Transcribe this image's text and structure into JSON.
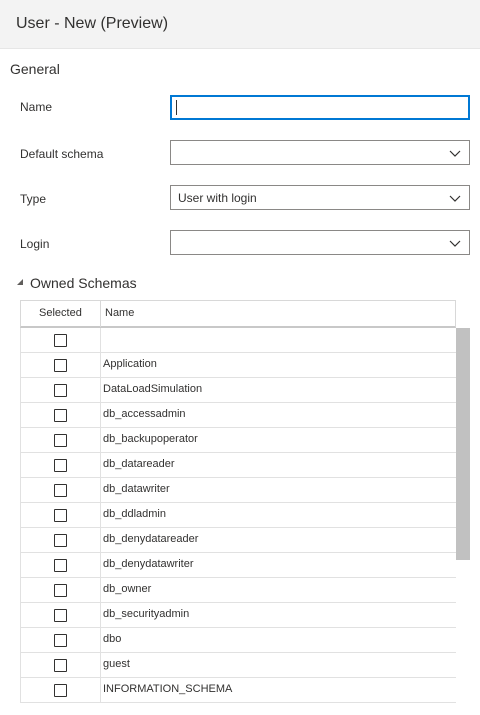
{
  "header": {
    "title": "User - New (Preview)"
  },
  "general": {
    "section_label": "General",
    "name": {
      "label": "Name",
      "value": ""
    },
    "default_schema": {
      "label": "Default schema",
      "value": ""
    },
    "type": {
      "label": "Type",
      "value": "User with login"
    },
    "login": {
      "label": "Login",
      "value": ""
    }
  },
  "owned_schemas": {
    "label": "Owned Schemas",
    "columns": {
      "selected": "Selected",
      "name": "Name"
    },
    "rows": [
      {
        "name": "",
        "selected": false
      },
      {
        "name": "Application",
        "selected": false
      },
      {
        "name": "DataLoadSimulation",
        "selected": false
      },
      {
        "name": "db_accessadmin",
        "selected": false
      },
      {
        "name": "db_backupoperator",
        "selected": false
      },
      {
        "name": "db_datareader",
        "selected": false
      },
      {
        "name": "db_datawriter",
        "selected": false
      },
      {
        "name": "db_ddladmin",
        "selected": false
      },
      {
        "name": "db_denydatareader",
        "selected": false
      },
      {
        "name": "db_denydatawriter",
        "selected": false
      },
      {
        "name": "db_owner",
        "selected": false
      },
      {
        "name": "db_securityadmin",
        "selected": false
      },
      {
        "name": "dbo",
        "selected": false
      },
      {
        "name": "guest",
        "selected": false
      },
      {
        "name": "INFORMATION_SCHEMA",
        "selected": false
      }
    ]
  },
  "colors": {
    "accent": "#0078d4",
    "header_bg": "#f3f3f3",
    "scroll_thumb": "#c1c1c1"
  },
  "icons": {
    "dropdown": "chevron-down-icon",
    "collapse": "triangle-down-icon"
  }
}
